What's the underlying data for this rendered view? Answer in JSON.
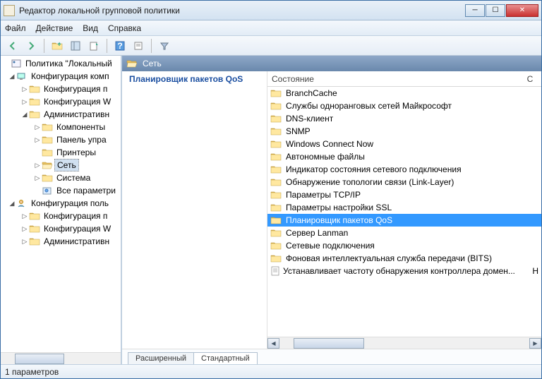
{
  "window": {
    "title": "Редактор локальной групповой политики"
  },
  "menu": {
    "file": "Файл",
    "action": "Действие",
    "view": "Вид",
    "help": "Справка"
  },
  "tree": {
    "root": "Политика \"Локальный",
    "comp_cfg": "Конфигурация комп",
    "soft_cfg1": "Конфигурация п",
    "win_cfg1": "Конфигурация W",
    "admin1": "Административн",
    "components": "Компоненты",
    "control_panel": "Панель упра",
    "printers": "Принтеры",
    "network": "Сеть",
    "system": "Система",
    "all_params": "Все параметри",
    "user_cfg": "Конфигурация поль",
    "soft_cfg2": "Конфигурация п",
    "win_cfg2": "Конфигурация W",
    "admin2": "Административн"
  },
  "breadcrumb": {
    "label": "Сеть"
  },
  "description": {
    "selected_title": "Планировщик пакетов QoS"
  },
  "columns": {
    "state": "Состояние",
    "c2": "С"
  },
  "items": [
    {
      "label": "BranchCache",
      "type": "folder"
    },
    {
      "label": "Службы одноранговых сетей Майкрософт",
      "type": "folder"
    },
    {
      "label": "DNS-клиент",
      "type": "folder"
    },
    {
      "label": "SNMP",
      "type": "folder"
    },
    {
      "label": "Windows Connect Now",
      "type": "folder"
    },
    {
      "label": "Автономные файлы",
      "type": "folder"
    },
    {
      "label": "Индикатор состояния сетевого подключения",
      "type": "folder"
    },
    {
      "label": "Обнаружение топологии связи (Link-Layer)",
      "type": "folder"
    },
    {
      "label": "Параметры TCP/IP",
      "type": "folder"
    },
    {
      "label": "Параметры настройки SSL",
      "type": "folder"
    },
    {
      "label": "Планировщик пакетов QoS",
      "type": "folder",
      "selected": true
    },
    {
      "label": "Сервер Lanman",
      "type": "folder"
    },
    {
      "label": "Сетевые подключения",
      "type": "folder"
    },
    {
      "label": "Фоновая интеллектуальная служба передачи (BITS)",
      "type": "folder"
    },
    {
      "label": "Устанавливает частоту обнаружения контроллера домен...",
      "type": "setting",
      "col2": "Н"
    }
  ],
  "tabs": {
    "extended": "Расширенный",
    "standard": "Стандартный"
  },
  "status": {
    "text": "1 параметров"
  }
}
